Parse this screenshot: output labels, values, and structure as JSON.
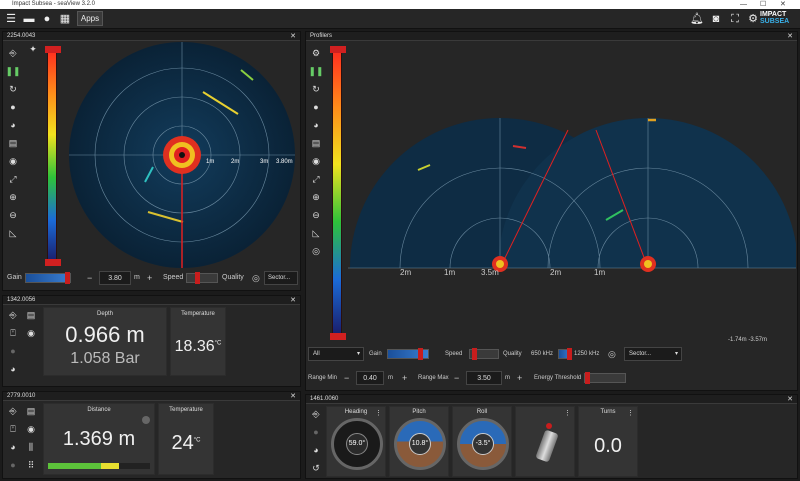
{
  "window": {
    "title": "Impact Subsea - seaView 3.2.0",
    "minimize": "—",
    "maximize": "☐",
    "close": "✕"
  },
  "toolbar": {
    "apps_label": "Apps",
    "logo_line1": "IMPACT",
    "logo_line2": "SUBSEA"
  },
  "sonar_panel": {
    "id": "2254.0043",
    "close": "✕",
    "ranges": [
      "1m",
      "2m",
      "3m",
      "3.80m"
    ],
    "gain_label": "Gain",
    "range_value": "3.80",
    "range_unit": "m",
    "speed_label": "Speed",
    "quality_label": "Quality",
    "sector_label": "Sector...",
    "minus": "−",
    "plus": "+"
  },
  "depth_panel": {
    "id": "1342.0056",
    "close": "✕",
    "depth_label": "Depth",
    "depth_value": "0.966 m",
    "pressure_value": "1.058 Bar",
    "temp_label": "Temperature",
    "temp_value": "18.36",
    "temp_unit": "°C"
  },
  "distance_panel": {
    "id": "2779.0010",
    "close": "✕",
    "distance_label": "Distance",
    "distance_value": "1.369 m",
    "distance_bar_fraction": 0.7,
    "temp_label": "Temperature",
    "temp_value": "24",
    "temp_unit": "°C"
  },
  "profiler_panel": {
    "title": "Profilers",
    "close": "✕",
    "left_ranges": [
      "2m",
      "1m",
      "3.5m"
    ],
    "right_ranges": [
      "2m",
      "1m"
    ],
    "coords": "-1.74m  -3.57m",
    "mode_value": "All",
    "gain_label": "Gain",
    "speed_label": "Speed",
    "quality_label": "Quality",
    "freq_low": "650 kHz",
    "freq_high": "1250 kHz",
    "sector_label": "Sector...",
    "range_min_label": "Range Min",
    "range_min_value": "0.40",
    "range_max_label": "Range Max",
    "range_max_value": "3.50",
    "unit": "m",
    "energy_label": "Energy Threshold",
    "minus": "−",
    "plus": "+"
  },
  "orientation_panel": {
    "id": "1461.0060",
    "close": "✕",
    "heading_label": "Heading",
    "heading_value": "59.0°",
    "pitch_label": "Pitch",
    "pitch_value": "10.8°",
    "roll_label": "Roll",
    "roll_value": "-3.5°",
    "turns_label": "Turns",
    "turns_value": "0.0",
    "more": "⋮"
  },
  "colors": {
    "accent": "#c81d1d",
    "panel": "#262626",
    "tile": "#343434",
    "sonar_bg": "#0d2a40"
  }
}
